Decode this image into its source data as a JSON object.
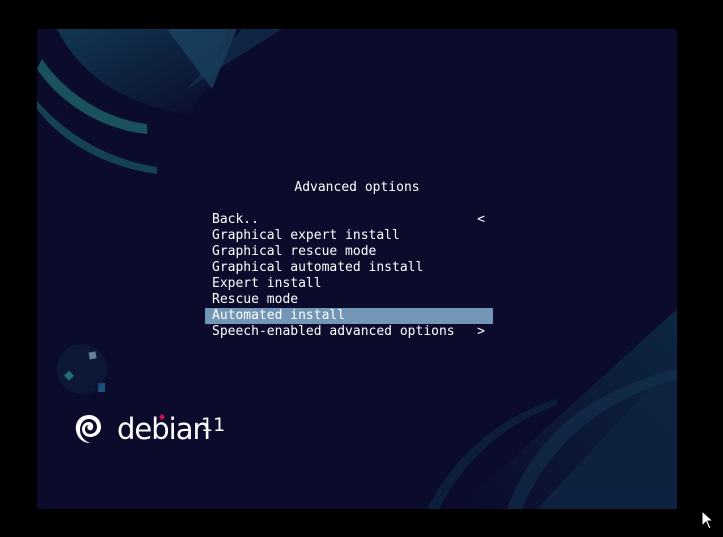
{
  "menu": {
    "title": "Advanced options",
    "items": [
      {
        "label": "Back..",
        "arrow": "<",
        "selected": false
      },
      {
        "label": "Graphical expert install",
        "arrow": "",
        "selected": false
      },
      {
        "label": "Graphical rescue mode",
        "arrow": "",
        "selected": false
      },
      {
        "label": "Graphical automated install",
        "arrow": "",
        "selected": false
      },
      {
        "label": "Expert install",
        "arrow": "",
        "selected": false
      },
      {
        "label": "Rescue mode",
        "arrow": "",
        "selected": false
      },
      {
        "label": "Automated install",
        "arrow": "",
        "selected": true
      },
      {
        "label": "Speech-enabled advanced options",
        "arrow": ">",
        "selected": false
      }
    ]
  },
  "logo": {
    "word": "debian",
    "version": "11",
    "icon": "debian-swirl-icon"
  },
  "colors": {
    "background": "#0b0b2c",
    "selection": "#7395b6",
    "text": "#ffffff",
    "accent_teal": "#1c6b73",
    "logo_dot": "#d70a53"
  },
  "cursor": {
    "icon": "mouse-pointer-icon"
  }
}
